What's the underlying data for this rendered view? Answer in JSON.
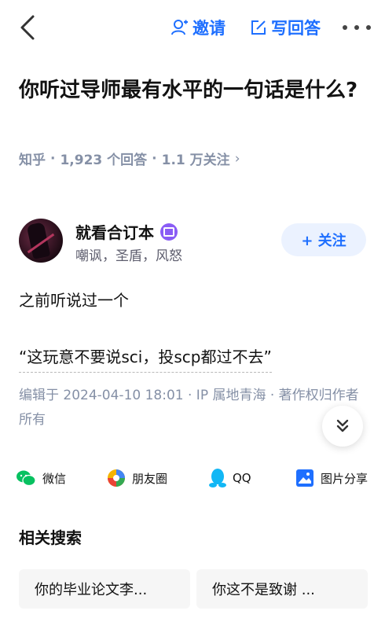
{
  "header": {
    "invite_label": "邀请",
    "write_label": "写回答",
    "accent": "#1e6fff"
  },
  "question": {
    "title": "你听过导师最有水平的一句话是什么?",
    "source": "知乎",
    "answers": "1,923 个回答",
    "followers": "1.1 万关注"
  },
  "answer": {
    "author_name": "就看合订本",
    "author_bio": "嘲讽，圣盾，风怒",
    "follow_label": "+ 关注",
    "paragraph1": "之前听说过一个",
    "paragraph2": "“这玩意不要说sci，投scp都过不去”",
    "edited": "编辑于 2024-04-10 18:01 · IP 属地青海 · 著作权归作者所有"
  },
  "share": {
    "wechat": "微信",
    "moments": "朋友圈",
    "qq": "QQ",
    "image_share": "图片分享"
  },
  "related": {
    "title": "相关搜索",
    "items": [
      "你的毕业论文李...",
      "你这不是致谢 ..."
    ]
  }
}
